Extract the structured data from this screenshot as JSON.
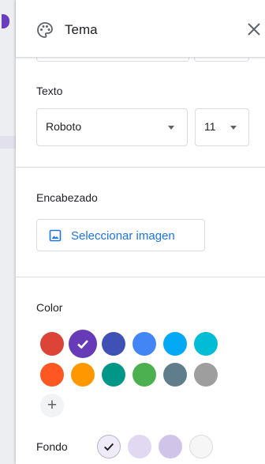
{
  "panel": {
    "title": "Tema",
    "title_icon": "palette-icon",
    "close_icon": "close-icon"
  },
  "text_section": {
    "label": "Texto",
    "font": "Roboto",
    "size": "11"
  },
  "header_section": {
    "label": "Encabezado",
    "button_label": "Seleccionar imagen",
    "button_icon": "image-icon"
  },
  "color_section": {
    "label": "Color",
    "theme_colors": [
      "#db4437",
      "#673ab7",
      "#3f51b5",
      "#4285f4",
      "#03a9f4",
      "#00bcd4",
      "#ff5722",
      "#ff9800",
      "#009688",
      "#4caf50",
      "#607d8b",
      "#9e9e9e"
    ],
    "selected_theme_color": "#673ab7",
    "add_label": "+",
    "background_label": "Fondo",
    "background_colors": [
      "#f0ebf8",
      "#e1d8f1",
      "#d1c4e9",
      "#f6f6f6"
    ],
    "selected_background": "#f0ebf8"
  },
  "colors": {
    "accent": "#1a73e8",
    "border": "#dadce0"
  }
}
